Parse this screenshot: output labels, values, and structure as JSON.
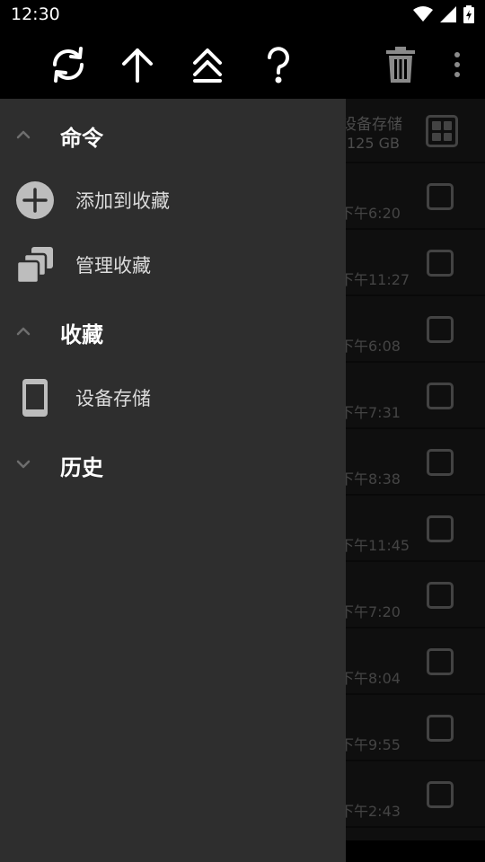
{
  "status_bar": {
    "time": "12:30"
  },
  "toolbar": {
    "actions": [
      "refresh-icon",
      "up-arrow-icon",
      "go-top-icon",
      "help-icon",
      "delete-icon",
      "more-vert-icon"
    ]
  },
  "file_list": {
    "storage_row": {
      "title": "设备存储",
      "size": "125 GB"
    },
    "times": [
      "下午6:20",
      "下午11:27",
      "下午6:08",
      "下午7:31",
      "下午8:38",
      "下午11:45",
      "下午7:20",
      "下午8:04",
      "下午9:55",
      "下午2:43"
    ]
  },
  "drawer": {
    "commands": {
      "title": "命令",
      "items": [
        {
          "label": "添加到收藏",
          "icon": "add-circle-icon"
        },
        {
          "label": "管理收藏",
          "icon": "manage-copies-icon"
        }
      ]
    },
    "favorites": {
      "title": "收藏",
      "items": [
        {
          "label": "设备存储",
          "icon": "phone-icon"
        }
      ]
    },
    "history": {
      "title": "历史"
    }
  }
}
